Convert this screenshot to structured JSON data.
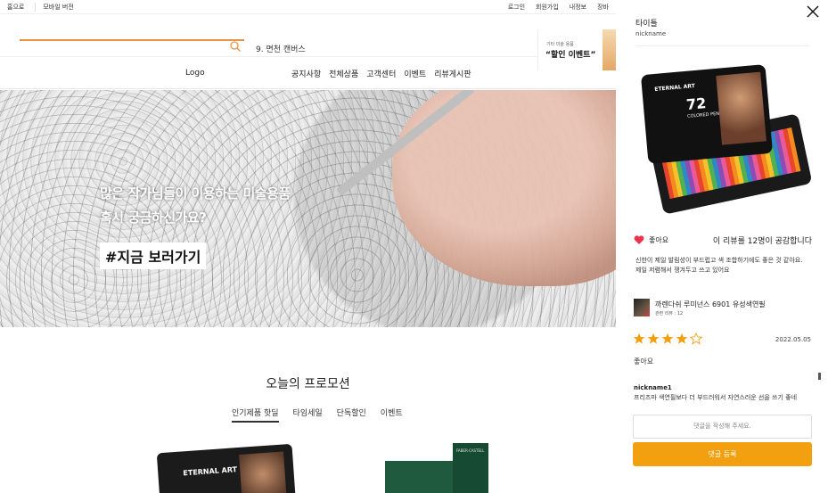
{
  "topbar": {
    "left": [
      "홈으로",
      "모바일 버전"
    ],
    "right": [
      "로그인",
      "회원가입",
      "내정보",
      "장바"
    ]
  },
  "search": {
    "keyword": "9. 면천 캔버스"
  },
  "promo_box": {
    "sub": "기타 미술 용품",
    "title": "“할인 이벤트”"
  },
  "header": {
    "logo": "Logo",
    "nav": [
      "공지사항",
      "전체상품",
      "고객센터",
      "이벤트",
      "리뷰게시판"
    ]
  },
  "hero": {
    "line1": "많은 작가님들이 이용하는 미술용품",
    "line2": "혹시 궁금하신가요?",
    "cta": "#지금 보러가기"
  },
  "promotion": {
    "heading": "오늘의 프로모션",
    "tabs": [
      "인기제품 핫딜",
      "타임세일",
      "단독할인",
      "이벤트"
    ],
    "products": [
      {
        "brand": "ETERNAL ART"
      },
      {
        "brand": "FABER-CASTELL"
      }
    ]
  },
  "panel": {
    "title": "타이틀",
    "nickname": "nickname",
    "image": {
      "brand": "ETERNAL ART",
      "number": "72",
      "sub": "COLORED PENCILS"
    },
    "like_label": "좋아요",
    "empathy": "이 리뷰를 12명이 공감합니다",
    "review_body": "신한이 제일 발림성이 부드럽고 색 조합하기에도 좋은 것 같아요. 제일 저렴해서 쟁겨두고 쓰고 있어요",
    "product_name": "까렌다쉬 루미넌스 6901 유성색연필",
    "product_reviews": "관련 리뷰 : 12",
    "rating": 4,
    "date": "2022.05.05",
    "review_text2": "좋아요",
    "comment_nick": "nickname1",
    "comment_text": "프리즈마 색연필보다 더 부드러워서 자연스러운 선을 쓰기 좋네",
    "comment_placeholder": "댓글을 작성해 주세요.",
    "submit_label": "댓글 등록"
  },
  "colors": {
    "accent": "#f2a00f",
    "search_line": "#e59445",
    "heart": "#e8334a",
    "star": "#f2a00f"
  }
}
